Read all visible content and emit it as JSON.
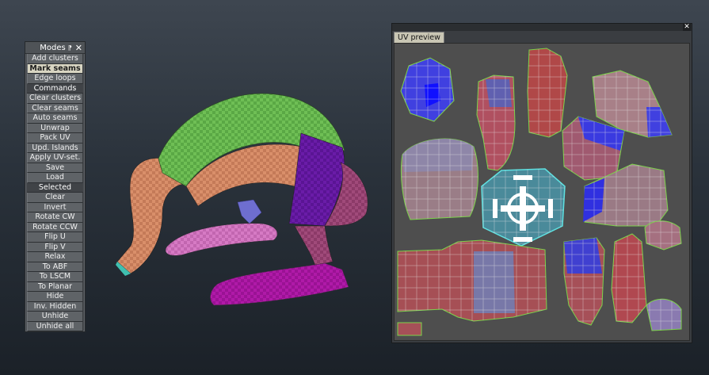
{
  "modes_panel": {
    "title": "Modes",
    "pin_glyph": "⁋",
    "close_glyph": "✕",
    "items": [
      {
        "label": "Add clusters",
        "kind": "button"
      },
      {
        "label": "Mark seams",
        "kind": "button",
        "active": true
      },
      {
        "label": "Edge loops",
        "kind": "button"
      },
      {
        "label": "Commands",
        "kind": "section"
      },
      {
        "label": "Clear clusters",
        "kind": "button"
      },
      {
        "label": "Clear seams",
        "kind": "button"
      },
      {
        "label": "Auto seams",
        "kind": "button"
      },
      {
        "label": "Unwrap",
        "kind": "button"
      },
      {
        "label": "Pack UV",
        "kind": "button"
      },
      {
        "label": "Upd. Islands",
        "kind": "button"
      },
      {
        "label": "Apply UV-set.",
        "kind": "button"
      },
      {
        "label": "Save",
        "kind": "button"
      },
      {
        "label": "Load",
        "kind": "button"
      },
      {
        "label": "Selected",
        "kind": "section"
      },
      {
        "label": "Clear",
        "kind": "button"
      },
      {
        "label": "Invert",
        "kind": "button"
      },
      {
        "label": "Rotate CW",
        "kind": "button"
      },
      {
        "label": "Rotate CCW",
        "kind": "button"
      },
      {
        "label": "Flip U",
        "kind": "button"
      },
      {
        "label": "Flip V",
        "kind": "button"
      },
      {
        "label": "Relax",
        "kind": "button"
      },
      {
        "label": "To ABF",
        "kind": "button"
      },
      {
        "label": "To LSCM",
        "kind": "button"
      },
      {
        "label": "To Planar",
        "kind": "button"
      },
      {
        "label": "Hide",
        "kind": "button"
      },
      {
        "label": "Inv. Hidden",
        "kind": "button"
      },
      {
        "label": "Unhide",
        "kind": "button"
      },
      {
        "label": "Unhide all",
        "kind": "button"
      }
    ]
  },
  "uv_window": {
    "tab_label": "UV preview",
    "close_glyph": "✕"
  },
  "colors": {
    "background_top": "#3e4650",
    "background_bottom": "#1b2128",
    "active_button": "#d8d5c2",
    "uv_background": "#4e4e4e",
    "seam_green": "#7cd34a",
    "selection_cyan": "#5fe0e0",
    "uv_red": "#b05050",
    "uv_blue": "#3030d0"
  }
}
